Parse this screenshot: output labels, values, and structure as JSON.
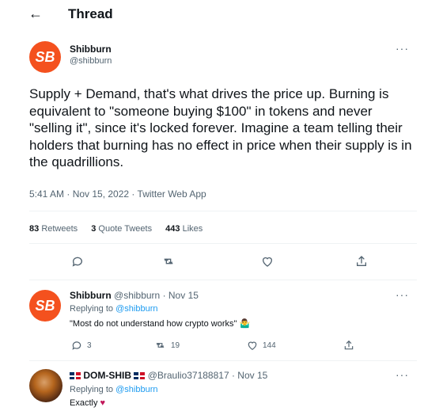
{
  "header": {
    "title": "Thread"
  },
  "main_tweet": {
    "avatar_text": "SB",
    "author_name": "Shibburn",
    "author_handle": "@shibburn",
    "text": "Supply + Demand, that's what drives the price up. Burning is equivalent to \"someone buying $100\" in tokens and never \"selling it\", since it's locked forever. Imagine a team telling their holders that burning has no effect in price when their supply is in the quadrillions.",
    "meta": "5:41 AM · Nov 15, 2022 · Twitter Web App",
    "stats": {
      "retweets_count": "83",
      "retweets_label": "Retweets",
      "quotes_count": "3",
      "quotes_label": "Quote Tweets",
      "likes_count": "443",
      "likes_label": "Likes"
    }
  },
  "replies": [
    {
      "avatar_text": "SB",
      "name": "Shibburn",
      "handle_date": "@shibburn · Nov 15",
      "replying_prefix": "Replying to",
      "replying_mention": "@shibburn",
      "text": "\"Most do not understand how crypto works\" 🤷‍♂️",
      "reply_count": "3",
      "retweet_count": "19",
      "like_count": "144"
    },
    {
      "name": "DOM-SHIB",
      "handle_date": "@Braulio37188817 · Nov 15",
      "replying_prefix": "Replying to",
      "replying_mention": "@shibburn",
      "text": "Exactly",
      "text_emoji": "♥"
    }
  ],
  "icons": {
    "back": "back-arrow-icon",
    "more": "more-icon",
    "reply": "reply-icon",
    "retweet": "retweet-icon",
    "like": "like-icon",
    "share": "share-icon"
  }
}
